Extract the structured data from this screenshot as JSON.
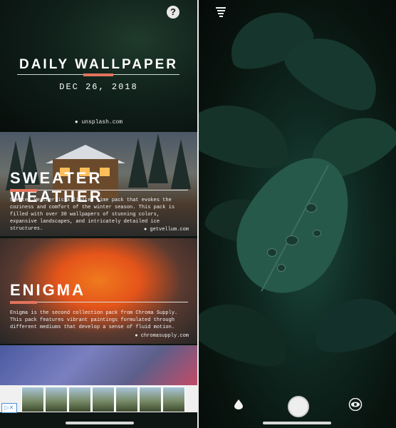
{
  "left": {
    "hero": {
      "title": "DAILY WALLPAPER",
      "date": "DEC 26, 2018",
      "credit": "unsplash.com",
      "help_icon": "help-icon",
      "help_glyph": "?"
    },
    "packs": [
      {
        "title": "SWEATER WEATHER",
        "description": "Sweater Weather is a limited time pack that evokes the coziness and comfort of the winter season. This pack is filled with over 30 wallpapers of stunning colors, expansive landscapes, and intricately detailed ice structures.",
        "credit": "getvellum.com"
      },
      {
        "title": "ENIGMA",
        "description": "Enigma is the second collection pack from Chroma Supply. This pack features vibrant paintings formulated through different mediums that develop a sense of fluid motion.",
        "credit": "chromasupply.com"
      }
    ],
    "ad": {
      "badge": "▷✕"
    }
  },
  "right": {
    "filter_icon": "filter-icon",
    "controls": {
      "blur_icon": "drop-icon",
      "capture_icon": "capture-button",
      "preview_icon": "eye-icon"
    }
  },
  "colors": {
    "accent": "#e2735d",
    "leaf": "#1f4a3d",
    "background": "#09140f"
  }
}
